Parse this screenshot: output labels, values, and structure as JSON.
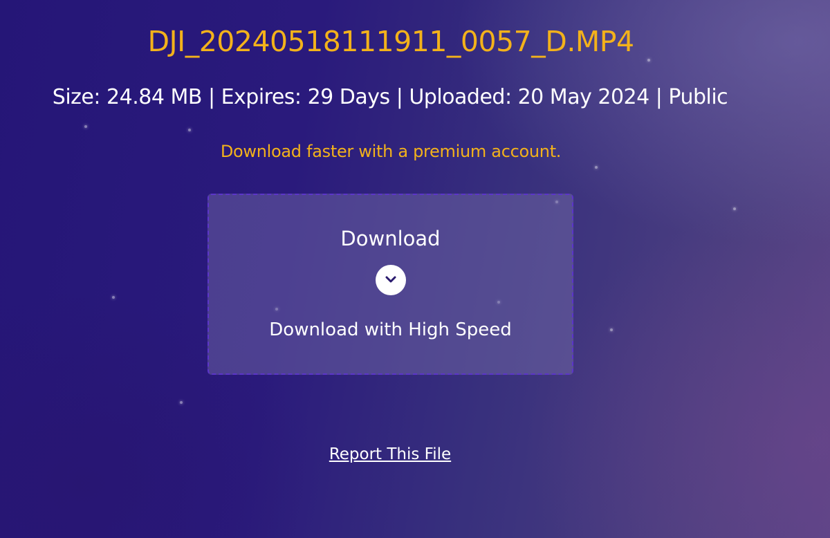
{
  "file": {
    "name": "DJI_20240518111911_0057_D.MP4",
    "meta": "Size: 24.84 MB | Expires: 29 Days | Uploaded: 20 May 2024 | Public"
  },
  "promo": {
    "text": "Download faster with a premium account."
  },
  "download": {
    "label": "Download",
    "icon": "chevron-down-icon",
    "sublabel": "Download with High Speed"
  },
  "report": {
    "label": "Report This File"
  },
  "colors": {
    "accent": "#f3b21b",
    "box_border": "#5c35c9",
    "background": "#2a1a7c"
  }
}
